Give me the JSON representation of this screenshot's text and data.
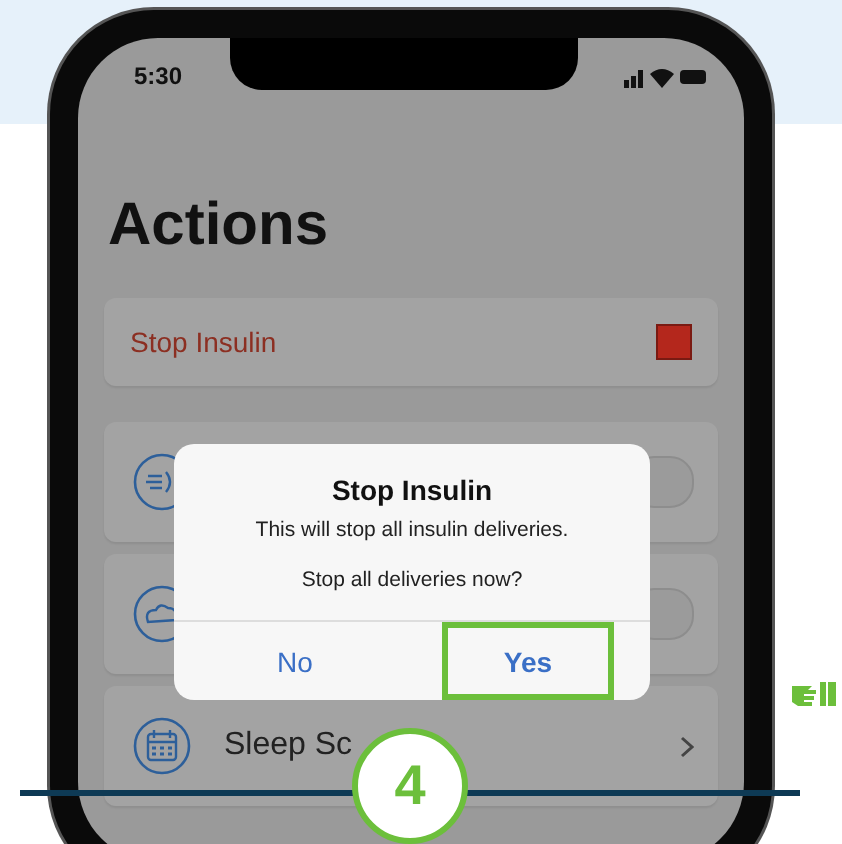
{
  "status_bar": {
    "time": "5:30"
  },
  "title": "Actions",
  "stop_card": {
    "label": "Stop Insulin"
  },
  "action_rows": [
    {
      "kind": "toggle",
      "on": false
    },
    {
      "kind": "toggle",
      "on": false
    },
    {
      "kind": "link",
      "label": "Sleep Sc"
    }
  ],
  "dialog": {
    "title": "Stop Insulin",
    "message": "This will stop all insulin deliveries.",
    "question": "Stop all deliveries now?",
    "buttons": [
      {
        "label": "No",
        "highlighted": false
      },
      {
        "label": "Yes",
        "highlighted": true
      }
    ]
  },
  "step_badge": "4"
}
